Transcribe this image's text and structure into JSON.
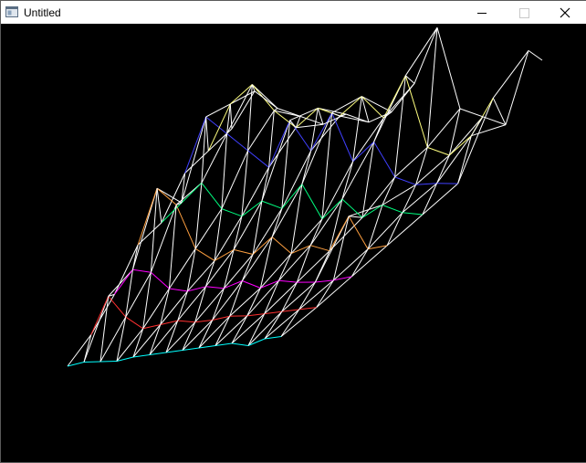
{
  "window": {
    "title": "Untitled",
    "background_color": "#000000",
    "titlebar_color": "#ffffff"
  },
  "controls": {
    "minimize": "minimize-icon",
    "maximize": "maximize-icon",
    "close": "close-icon"
  },
  "chart_data": {
    "type": "surface-wireframe",
    "title": "",
    "xlabel": "",
    "ylabel": "",
    "zlabel": "",
    "grid": false,
    "legend": "none",
    "line_color_scheme": [
      "#00ffff",
      "#ff3030",
      "#ff00ff",
      "#ffa040",
      "#00ff80",
      "#4040ff",
      "#ffff80",
      "#ffffff"
    ],
    "note_rows": 8,
    "note_cols": 14
  }
}
